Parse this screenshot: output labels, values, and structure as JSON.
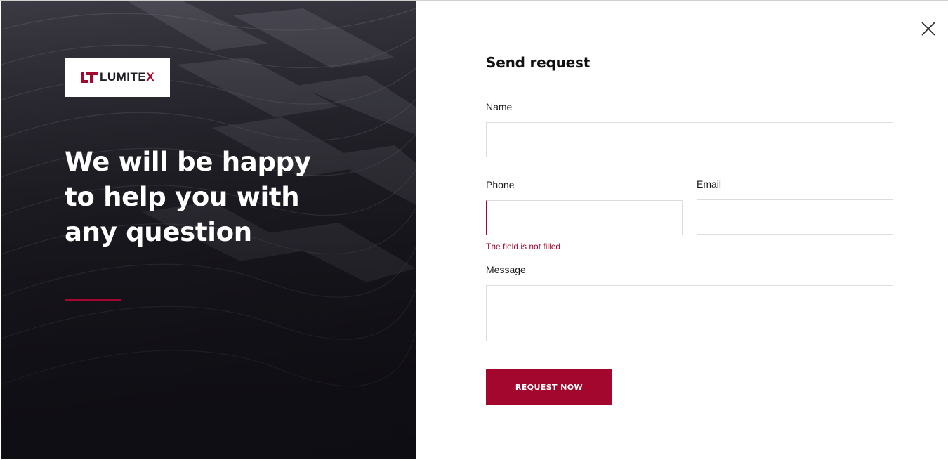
{
  "brand": {
    "logo_text_main": "LUMITE",
    "logo_text_accent": "X",
    "accent_color": "#a3072e"
  },
  "hero": {
    "headline_line1": "We will be happy",
    "headline_line2": "to help you with",
    "headline_line3": "any question"
  },
  "form": {
    "title": "Send request",
    "name_label": "Name",
    "name_value": "",
    "phone_label": "Phone",
    "phone_value": "",
    "phone_error": "The field is not filled",
    "email_label": "Email",
    "email_value": "",
    "message_label": "Message",
    "message_value": "",
    "submit_label": "REQUEST NOW"
  },
  "icons": {
    "close": "close-icon",
    "logo_mark": "lumitex-logo-mark-icon"
  }
}
